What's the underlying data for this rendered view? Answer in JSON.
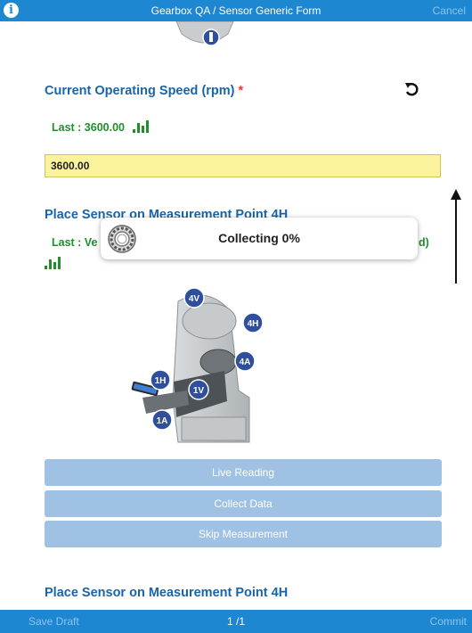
{
  "header": {
    "title": "Gearbox QA / Sensor Generic Form",
    "cancel_label": "Cancel",
    "info_label": "i"
  },
  "speed": {
    "title": "Current Operating Speed (rpm)",
    "required_marker": "*",
    "last_label": "Last : 3600.00",
    "value": "3600.00"
  },
  "measurement": {
    "title": "Place Sensor on Measurement Point 4H",
    "last_label": "Last : Ve",
    "trailing_text": "d)"
  },
  "toast": {
    "label": "Collecting 0%"
  },
  "points": [
    "4V",
    "4H",
    "4A",
    "1H",
    "1V",
    "1A"
  ],
  "buttons": {
    "live": "Live Reading",
    "collect": "Collect Data",
    "skip": "Skip Measurement"
  },
  "next_section": {
    "title": "Place Sensor on Measurement Point 4H"
  },
  "footer": {
    "save_label": "Save Draft",
    "page_label": "1 /1",
    "commit_label": "Commit"
  },
  "colors": {
    "accent": "#1d88d1",
    "title": "#1a64a8",
    "last": "#1f8e2b",
    "button": "#9fc1e3",
    "input_bg": "#fbf39c"
  }
}
